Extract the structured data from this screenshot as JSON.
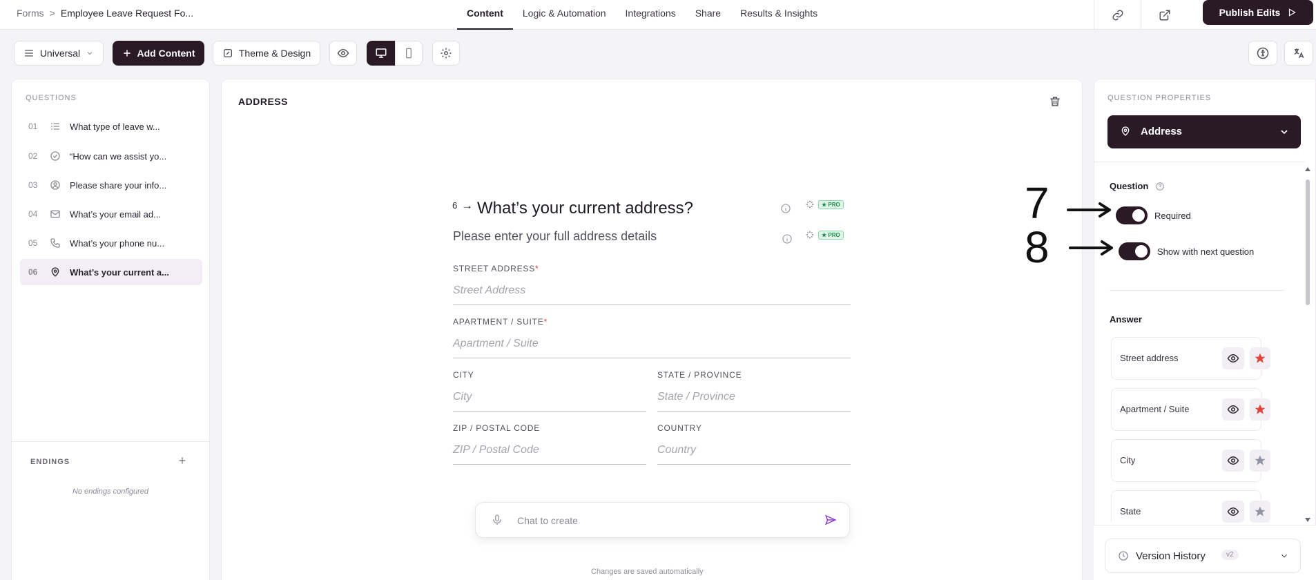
{
  "breadcrumb": {
    "root": "Forms",
    "sep": ">",
    "current": "Employee Leave Request Fo..."
  },
  "nav_tabs": [
    "Content",
    "Logic & Automation",
    "Integrations",
    "Share",
    "Results & Insights"
  ],
  "publish_label": "Publish Edits",
  "toolbar": {
    "universal": "Universal",
    "add_content": "Add Content",
    "theme": "Theme & Design"
  },
  "questions_panel": {
    "title": "QUESTIONS",
    "items": [
      {
        "num": "01",
        "icon": "list-icon",
        "text": "What type of leave w..."
      },
      {
        "num": "02",
        "icon": "check-circle-icon",
        "text": "“How can we assist yo..."
      },
      {
        "num": "03",
        "icon": "user-circle-icon",
        "text": "Please share your info..."
      },
      {
        "num": "04",
        "icon": "mail-icon",
        "text": "What’s your email ad..."
      },
      {
        "num": "05",
        "icon": "phone-icon",
        "text": "What’s your phone nu..."
      },
      {
        "num": "06",
        "icon": "location-pin-icon",
        "text": "What’s your current a..."
      }
    ],
    "endings_title": "ENDINGS",
    "endings_empty": "No endings configured"
  },
  "editor": {
    "section_title": "ADDRESS",
    "question_number": "6",
    "arrow": "→",
    "question_title": "What’s your current address?",
    "description": "Please enter your full address details",
    "pro_badge": "★ PRO",
    "fields": {
      "street": {
        "label": "STREET ADDRESS",
        "required": "*",
        "placeholder": "Street Address"
      },
      "apartment": {
        "label": "APARTMENT / SUITE",
        "required": "*",
        "placeholder": "Apartment / Suite"
      },
      "city": {
        "label": "CITY",
        "placeholder": "City"
      },
      "state": {
        "label": "STATE / PROVINCE",
        "placeholder": "State / Province"
      },
      "zip": {
        "label": "ZIP / POSTAL CODE",
        "placeholder": "ZIP / Postal Code"
      },
      "country": {
        "label": "COUNTRY",
        "placeholder": "Country"
      }
    },
    "chat_placeholder": "Chat to create",
    "autosave": "Changes are saved automatically"
  },
  "properties": {
    "title": "QUESTION PROPERTIES",
    "type_label": "Address",
    "question_heading": "Question",
    "required_label": "Required",
    "show_next_label": "Show with next question",
    "required_on": true,
    "show_next_on": true,
    "annotation_7": "7",
    "annotation_8": "8",
    "answer_heading": "Answer",
    "answer_rows": [
      {
        "label": "Street address",
        "required": true
      },
      {
        "label": "Apartment / Suite",
        "required": true
      },
      {
        "label": "City",
        "required": false
      },
      {
        "label": "State",
        "required": false
      }
    ],
    "version_history": "Version History",
    "version_badge": "v2"
  },
  "colors": {
    "dark": "#2a1a26",
    "required_star": "#e0443a",
    "muted_star": "#8f93a3",
    "accent_purple": "#8b3fd1"
  }
}
